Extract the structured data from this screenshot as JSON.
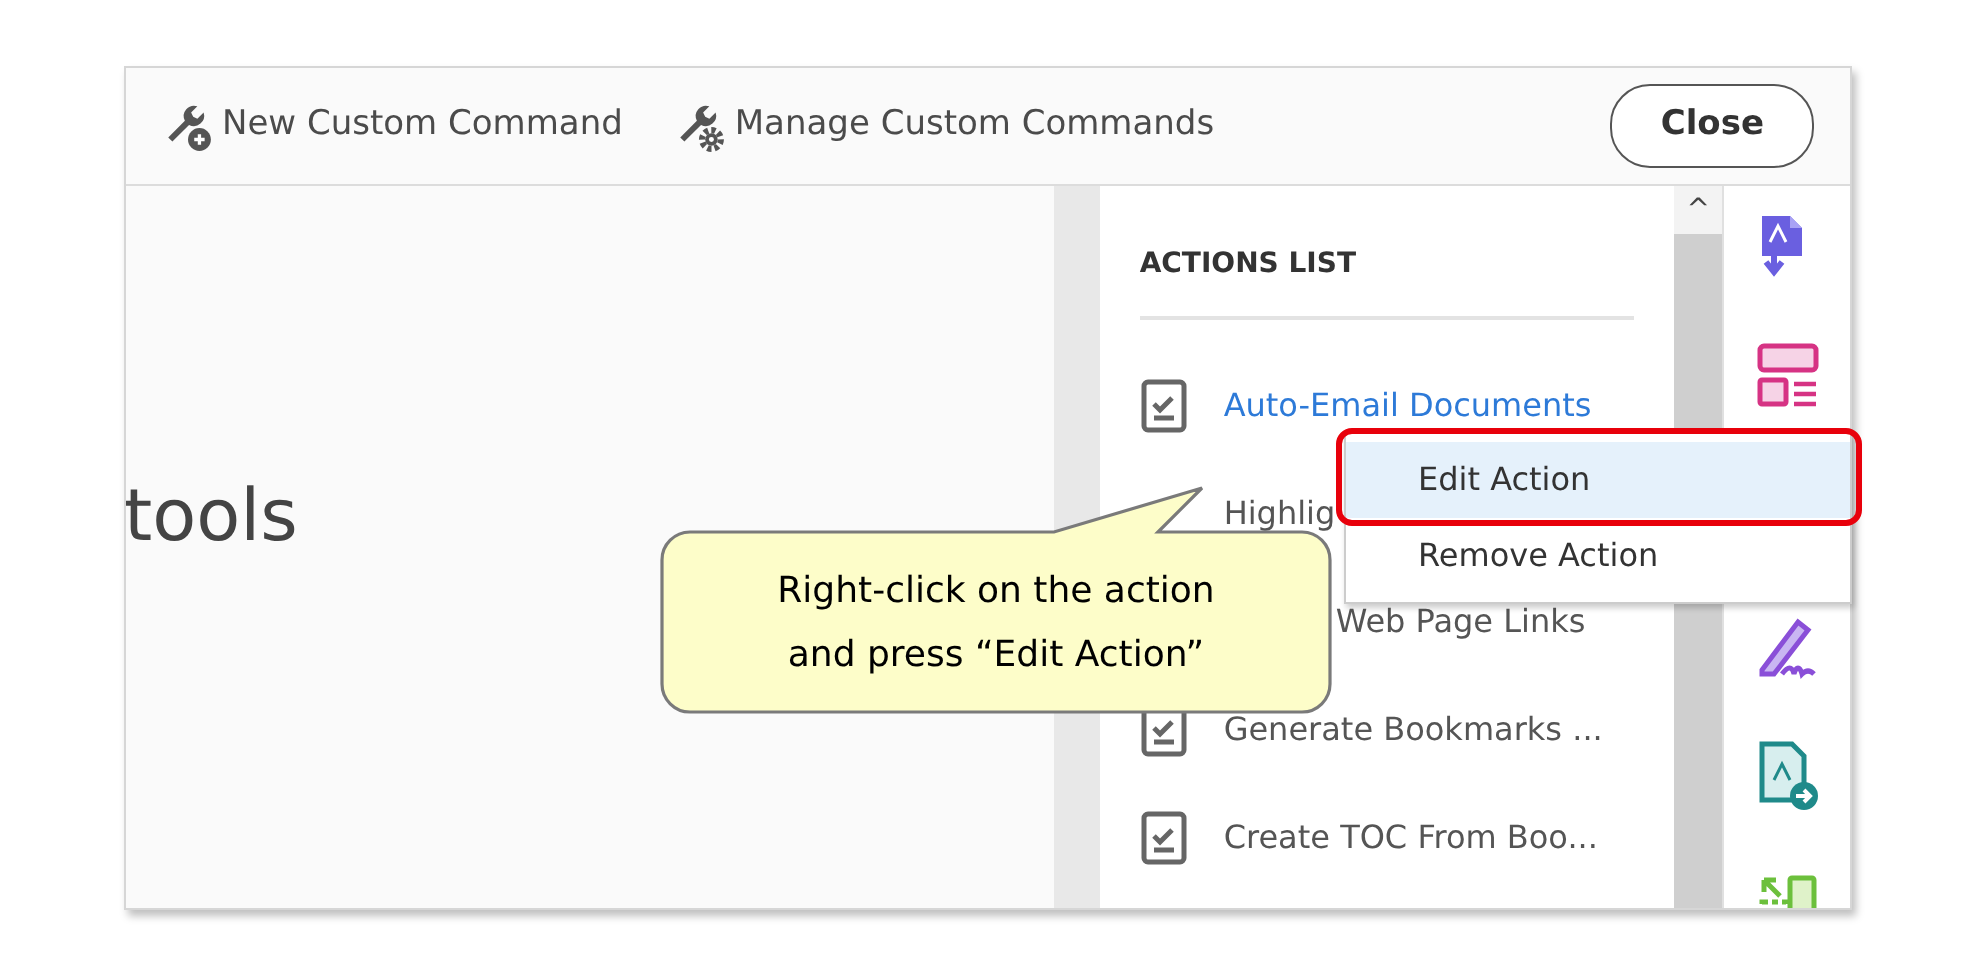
{
  "toolbar": {
    "buttons": [
      {
        "label": "New Custom Command",
        "kind": "new"
      },
      {
        "label": "Manage Custom Commands",
        "kind": "manage"
      }
    ],
    "close": "Close"
  },
  "main": {
    "heading": "tools"
  },
  "actions_list": {
    "title": "ACTIONS LIST",
    "items": [
      {
        "label": "Auto-Email Documents",
        "kind": "link"
      },
      {
        "label": "Highlig",
        "kind": "clipped"
      },
      {
        "label": "Web Page Links",
        "kind": "shifted"
      },
      {
        "label": "Generate Bookmarks ...",
        "kind": "plain"
      },
      {
        "label": "Create TOC From Boo...",
        "kind": "plain"
      }
    ]
  },
  "scrollbar": {
    "up": "^"
  },
  "context_menu": {
    "items": [
      {
        "label": "Edit Action",
        "selected": true
      },
      {
        "label": "Remove Action",
        "selected": false
      }
    ]
  },
  "callout": {
    "lines": [
      "Right-click on the action",
      "and press “Edit Action”"
    ]
  },
  "tool_icons": [
    {
      "kind": "export"
    },
    {
      "kind": "organize"
    },
    {
      "kind": "sign"
    },
    {
      "kind": "send"
    },
    {
      "kind": "compare"
    }
  ]
}
